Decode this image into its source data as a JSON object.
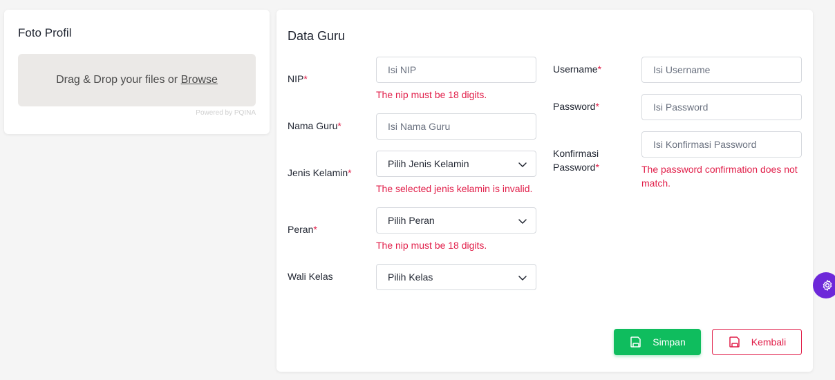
{
  "photo": {
    "title": "Foto Profil",
    "drop_text": "Drag & Drop your files or ",
    "browse": "Browse",
    "powered": "Powered by PQINA"
  },
  "form": {
    "title": "Data Guru",
    "required_mark": "*",
    "nip": {
      "label": "NIP",
      "placeholder": "Isi NIP",
      "error": "The nip must be 18 digits."
    },
    "nama": {
      "label": "Nama Guru",
      "placeholder": "Isi Nama Guru"
    },
    "jenis": {
      "label": "Jenis Kelamin",
      "value": "Pilih Jenis Kelamin",
      "error": "The selected jenis kelamin is invalid."
    },
    "peran": {
      "label": "Peran",
      "value": "Pilih Peran",
      "error": "The nip must be 18 digits."
    },
    "wali": {
      "label": "Wali Kelas",
      "value": "Pilih Kelas"
    },
    "username": {
      "label": "Username",
      "placeholder": "Isi Username"
    },
    "password": {
      "label": "Password",
      "placeholder": "Isi Password"
    },
    "konfirmasi": {
      "label_line1": "Konfirmasi",
      "label_line2": "Password",
      "placeholder": "Isi Konfirmasi Password",
      "error_line1": "The password confirmation does not",
      "error_line2": "match."
    }
  },
  "buttons": {
    "save": "Simpan",
    "back": "Kembali"
  },
  "colors": {
    "save": "#0fbd5e",
    "back": "#e11d48",
    "error": "#e11d48",
    "fab": "#6d28d9"
  },
  "icons": {
    "save": "save-icon",
    "back": "save-icon",
    "fab": "gear-icon",
    "select": "chevron-down-icon"
  }
}
